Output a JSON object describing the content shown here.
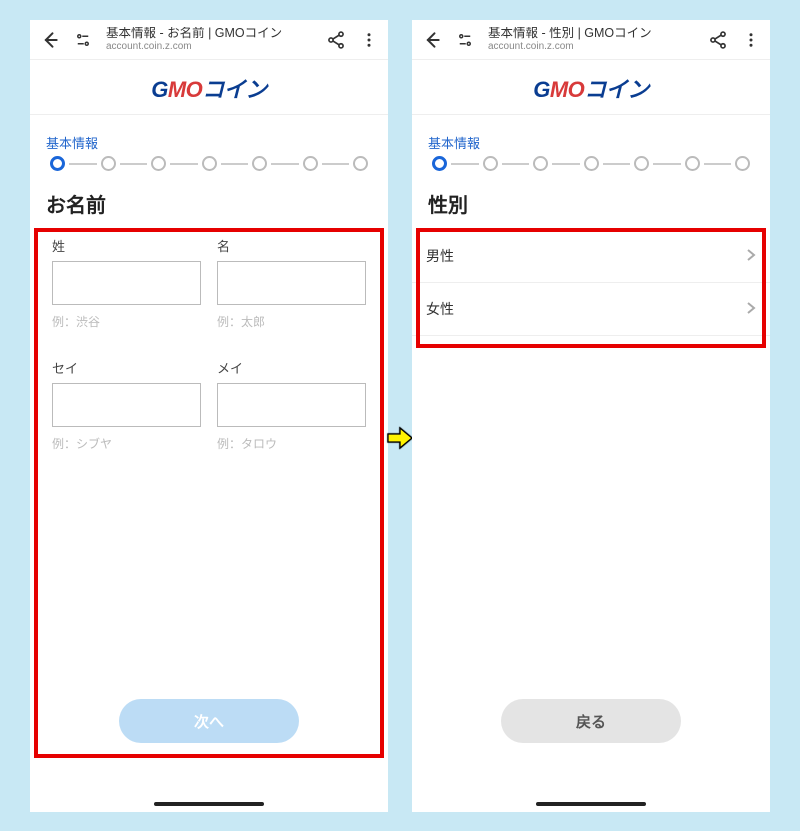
{
  "left": {
    "browser": {
      "title": "基本情報 - お名前 | GMOコイン",
      "url": "account.coin.z.com"
    },
    "section_label": "基本情報",
    "page_title": "お名前",
    "fields": {
      "sei": {
        "label": "姓",
        "hint": "例：渋谷"
      },
      "mei": {
        "label": "名",
        "hint": "例：太郎"
      },
      "sei_kana": {
        "label": "セイ",
        "hint": "例：シブヤ"
      },
      "mei_kana": {
        "label": "メイ",
        "hint": "例：タロウ"
      }
    },
    "next_label": "次へ"
  },
  "right": {
    "browser": {
      "title": "基本情報 - 性別 | GMOコイン",
      "url": "account.coin.z.com"
    },
    "section_label": "基本情報",
    "page_title": "性別",
    "options": {
      "male": "男性",
      "female": "女性"
    },
    "back_label": "戻る"
  },
  "logo": {
    "g": "G",
    "mo": "MO",
    "jp": "コイン"
  },
  "steps_total": 7,
  "active_step": 0
}
